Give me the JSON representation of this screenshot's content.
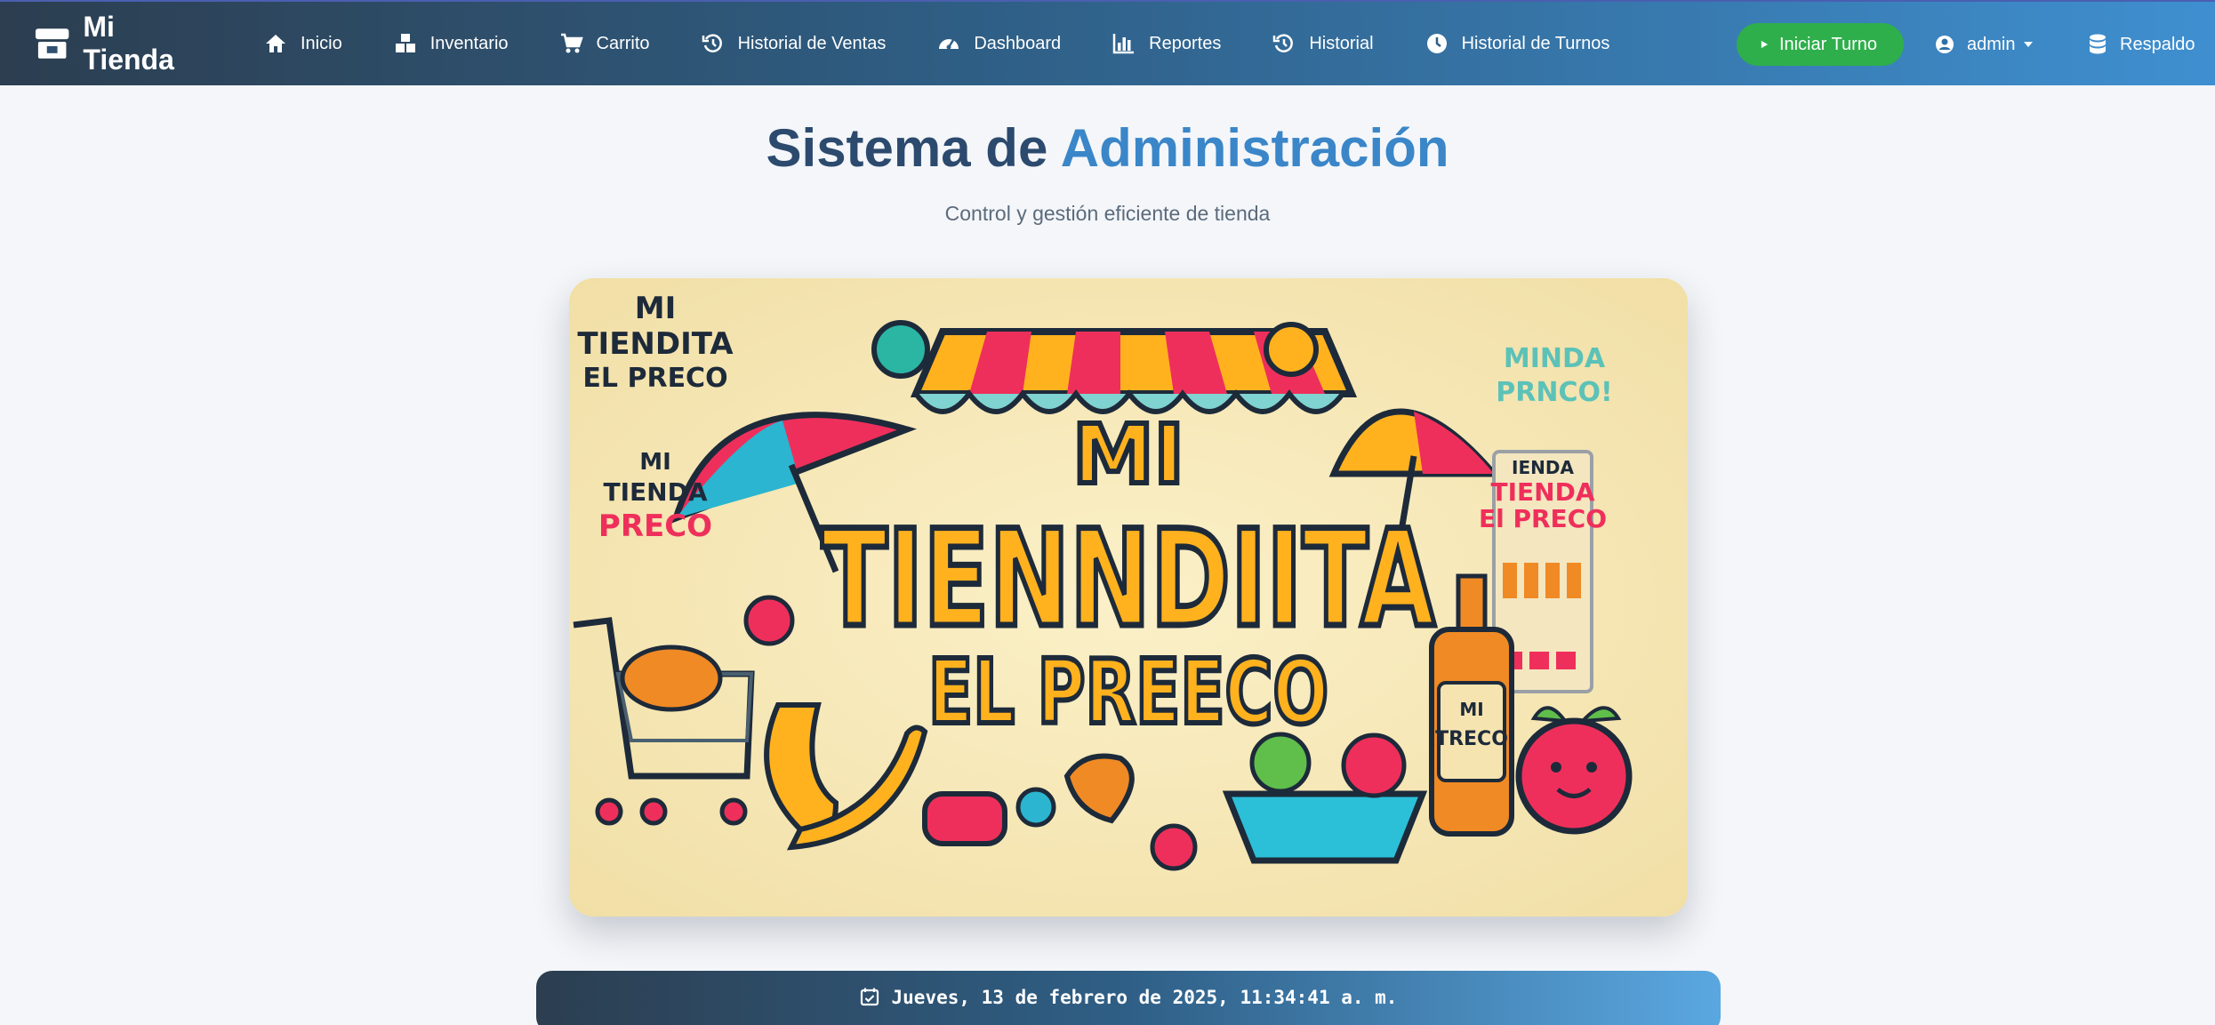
{
  "brand": {
    "name": "Mi Tienda",
    "icon": "store-icon"
  },
  "nav": [
    {
      "label": "Inicio",
      "icon": "home-icon"
    },
    {
      "label": "Inventario",
      "icon": "boxes-icon"
    },
    {
      "label": "Carrito",
      "icon": "cart-icon"
    },
    {
      "label": "Historial de Ventas",
      "icon": "history-icon"
    },
    {
      "label": "Dashboard",
      "icon": "gauge-icon"
    },
    {
      "label": "Reportes",
      "icon": "bar-chart-icon"
    },
    {
      "label": "Historial",
      "icon": "history-icon"
    },
    {
      "label": "Historial de Turnos",
      "icon": "clock-icon"
    }
  ],
  "actions": {
    "start_shift": "Iniciar Turno",
    "user": "admin",
    "backup": "Respaldo"
  },
  "header": {
    "title_part1": "Sistema de ",
    "title_part2": "Administración",
    "subtitle": "Control y gestión eficiente de tienda"
  },
  "banner": {
    "main_line1": "MI",
    "main_line2": "TIENNDIITA",
    "main_line3": "EL PREECO",
    "corner_tl_1": "MI",
    "corner_tl_2": "TIENDITA",
    "corner_tl_3": "EL PRECO",
    "left_1": "MI",
    "left_2": "TIENDA",
    "left_3": "PRECO",
    "corner_tr_1": "MINDA",
    "corner_tr_2": "PRNCO!",
    "right_1": "IENDA",
    "right_2": "TIENDA",
    "right_3": "El PRECO",
    "bottle_1": "MI",
    "bottle_2": "TRECO"
  },
  "datetime": "Jueves, 13 de febrero de 2025, 11:34:41 a. m.",
  "colors": {
    "nav_start": "#2c3e50",
    "nav_end": "#3f8fd0",
    "accent": "#3a86c8",
    "success": "#2eaf4b",
    "page_bg": "#f4f6f9"
  }
}
